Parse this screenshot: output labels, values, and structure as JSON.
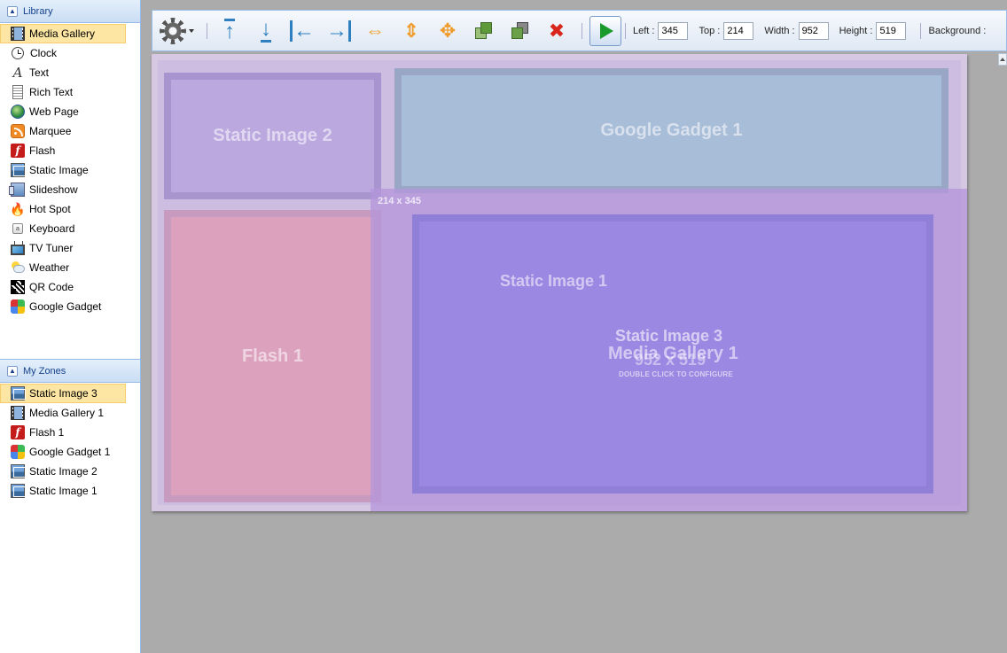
{
  "library": {
    "title": "Library",
    "items": [
      {
        "label": "Media Gallery",
        "icon": "film-icon",
        "selected": true
      },
      {
        "label": "Clock",
        "icon": "clock-icon"
      },
      {
        "label": "Text",
        "icon": "text-icon"
      },
      {
        "label": "Rich Text",
        "icon": "rich-text-icon"
      },
      {
        "label": "Web Page",
        "icon": "globe-icon"
      },
      {
        "label": "Marquee",
        "icon": "rss-icon"
      },
      {
        "label": "Flash",
        "icon": "flash-icon"
      },
      {
        "label": "Static Image",
        "icon": "image-icon"
      },
      {
        "label": "Slideshow",
        "icon": "slideshow-icon"
      },
      {
        "label": "Hot Spot",
        "icon": "fire-icon"
      },
      {
        "label": "Keyboard",
        "icon": "keyboard-icon"
      },
      {
        "label": "TV Tuner",
        "icon": "tv-icon"
      },
      {
        "label": "Weather",
        "icon": "weather-icon"
      },
      {
        "label": "QR Code",
        "icon": "qr-code-icon"
      },
      {
        "label": "Google Gadget",
        "icon": "google-gadget-icon"
      }
    ]
  },
  "zones_panel": {
    "title": "My Zones",
    "items": [
      {
        "label": "Static Image 3",
        "icon": "image-icon",
        "selected": true
      },
      {
        "label": "Media Gallery 1",
        "icon": "film-icon"
      },
      {
        "label": "Flash 1",
        "icon": "flash-icon"
      },
      {
        "label": "Google Gadget 1",
        "icon": "google-gadget-icon"
      },
      {
        "label": "Static Image 2",
        "icon": "image-icon"
      },
      {
        "label": "Static Image 1",
        "icon": "image-icon"
      }
    ]
  },
  "toolbar": {
    "left_label": "Left :",
    "left_value": "345",
    "top_label": "Top :",
    "top_value": "214",
    "width_label": "Width :",
    "width_value": "952",
    "height_label": "Height :",
    "height_value": "519",
    "background_label": "Background :"
  },
  "canvas": {
    "zones": {
      "static_image_2": "Static Image 2",
      "google_gadget_1": "Google Gadget 1",
      "flash_1": "Flash 1",
      "static_image_1": "Static Image 1",
      "static_image_3": "Static Image 3",
      "media_gallery_1": "Media Gallery 1"
    },
    "selection_size": "214 x 345",
    "selected_dims": "952 x 519",
    "hint": "DOUBLE CLICK TO CONFIGURE"
  },
  "colors": {
    "panel_header": "#c9ddf4",
    "selected_item": "#fde6a3",
    "workspace": "#ababab"
  }
}
